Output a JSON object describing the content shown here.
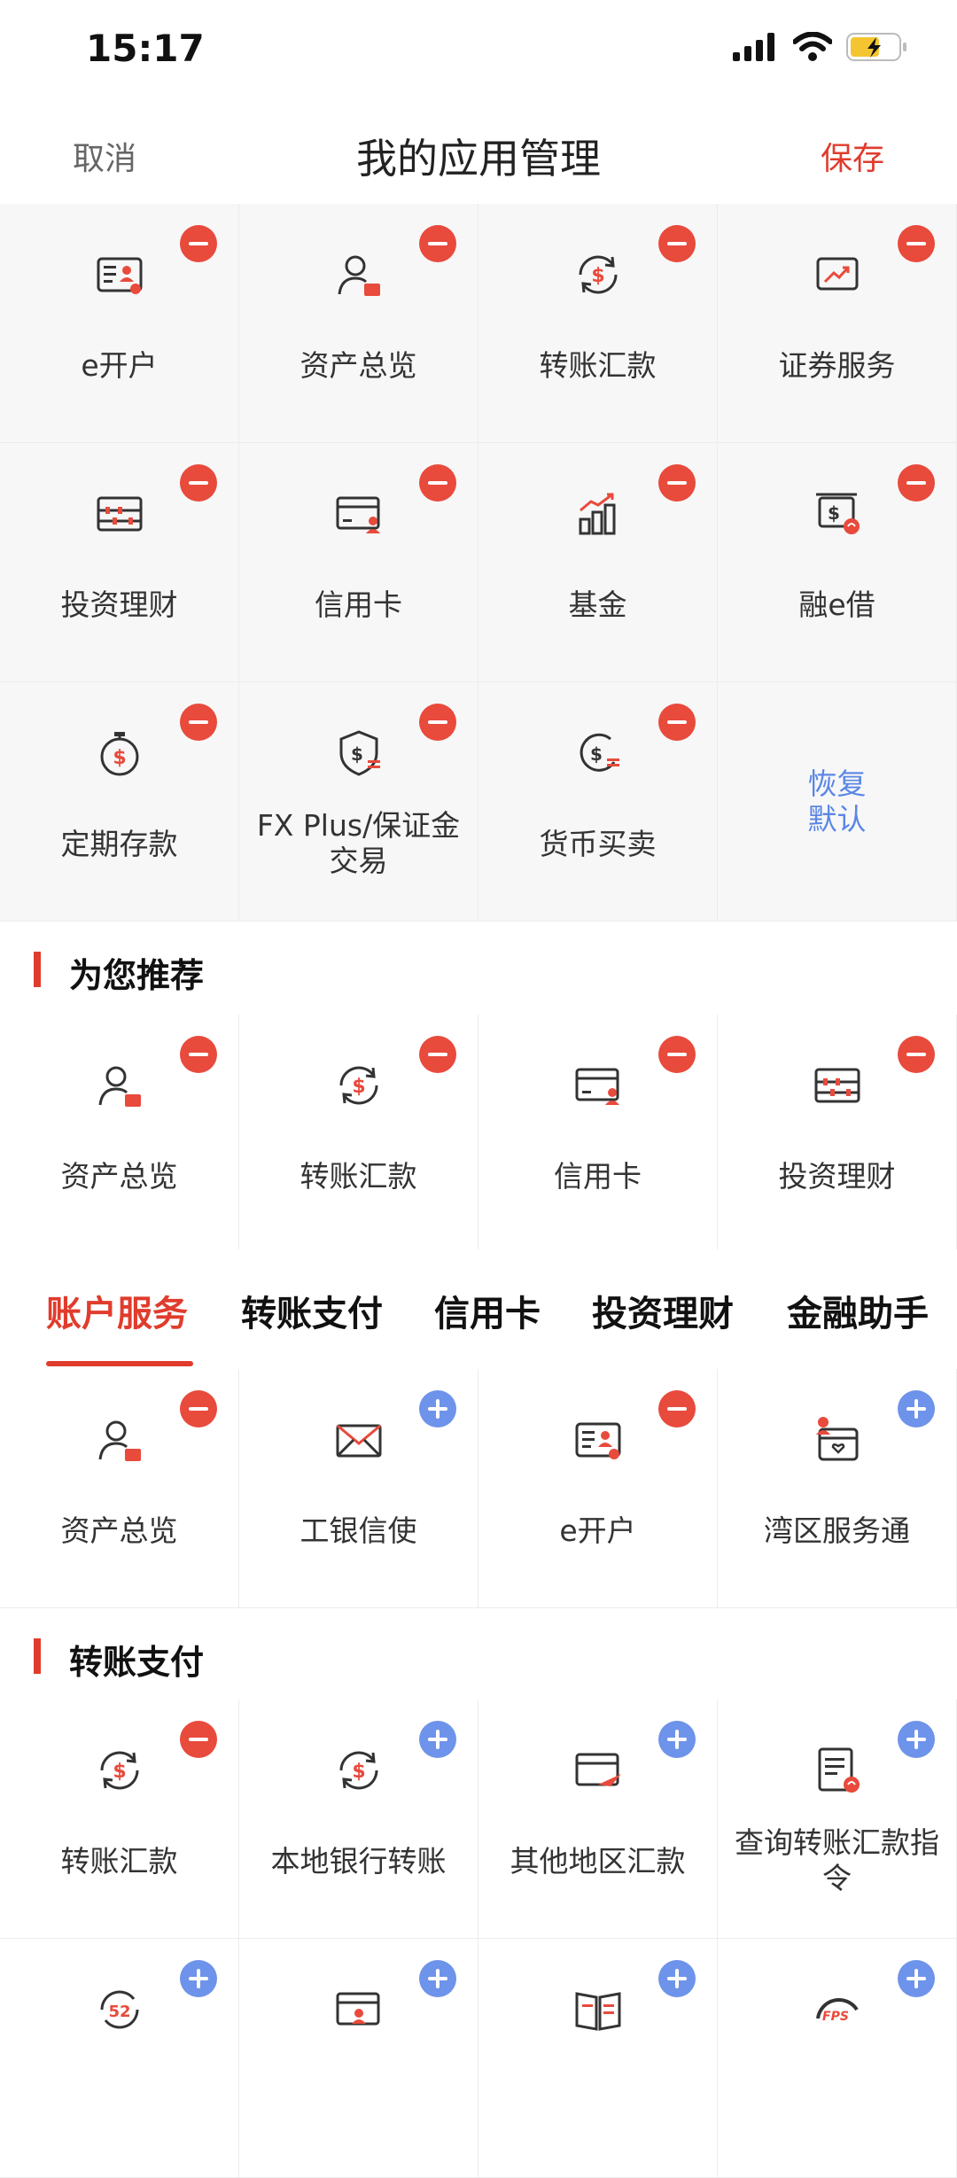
{
  "status_bar": {
    "time": "15:17"
  },
  "nav": {
    "cancel": "取消",
    "title": "我的应用管理",
    "save": "保存"
  },
  "my_apps": [
    {
      "label": "e开户",
      "icon": "id-card-icon",
      "badge": "remove"
    },
    {
      "label": "资产总览",
      "icon": "person-wallet-icon",
      "badge": "remove"
    },
    {
      "label": "转账汇款",
      "icon": "dollar-cycle-icon",
      "badge": "remove"
    },
    {
      "label": "证券服务",
      "icon": "chart-screen-icon",
      "badge": "remove"
    },
    {
      "label": "投资理财",
      "icon": "abacus-icon",
      "badge": "remove"
    },
    {
      "label": "信用卡",
      "icon": "credit-card-icon",
      "badge": "remove"
    },
    {
      "label": "基金",
      "icon": "bar-growth-icon",
      "badge": "remove"
    },
    {
      "label": "融e借",
      "icon": "loan-icon",
      "badge": "remove"
    },
    {
      "label": "定期存款",
      "icon": "stopwatch-dollar-icon",
      "badge": "remove"
    },
    {
      "label": "FX Plus/保证金交易",
      "icon": "shield-dollar-icon",
      "badge": "remove"
    },
    {
      "label": "货币买卖",
      "icon": "currency-exchange-icon",
      "badge": "remove"
    }
  ],
  "restore_default": "恢复\n默认",
  "recommend": {
    "title": "为您推荐",
    "items": [
      {
        "label": "资产总览",
        "icon": "person-wallet-icon",
        "badge": "remove"
      },
      {
        "label": "转账汇款",
        "icon": "dollar-cycle-icon",
        "badge": "remove"
      },
      {
        "label": "信用卡",
        "icon": "credit-card-icon",
        "badge": "remove"
      },
      {
        "label": "投资理财",
        "icon": "abacus-icon",
        "badge": "remove"
      }
    ]
  },
  "category_tabs": [
    "账户服务",
    "转账支付",
    "信用卡",
    "投资理财",
    "金融助手"
  ],
  "account_services": [
    {
      "label": "资产总览",
      "icon": "person-wallet-icon",
      "badge": "remove"
    },
    {
      "label": "工银信使",
      "icon": "envelope-icon",
      "badge": "add"
    },
    {
      "label": "e开户",
      "icon": "id-card-icon",
      "badge": "remove"
    },
    {
      "label": "湾区服务通",
      "icon": "bay-area-icon",
      "badge": "add"
    }
  ],
  "transfer": {
    "title": "转账支付",
    "items": [
      {
        "label": "转账汇款",
        "icon": "dollar-cycle-icon",
        "badge": "remove"
      },
      {
        "label": "本地银行转账",
        "icon": "dollar-cycle-icon",
        "badge": "add"
      },
      {
        "label": "其他地区汇款",
        "icon": "card-plane-icon",
        "badge": "add"
      },
      {
        "label": "查询转账汇款指令",
        "icon": "document-query-icon",
        "badge": "add"
      },
      {
        "label": "",
        "icon": "cycle-52-icon",
        "badge": "add"
      },
      {
        "label": "",
        "icon": "card-person-icon",
        "badge": "add"
      },
      {
        "label": "",
        "icon": "book-icon",
        "badge": "add"
      },
      {
        "label": "",
        "icon": "fps-icon",
        "badge": "add"
      }
    ]
  },
  "colors": {
    "accent": "#e03c2d",
    "remove_badge": "#e84a3c",
    "add_badge": "#6e93ea",
    "link": "#5a86e6"
  }
}
